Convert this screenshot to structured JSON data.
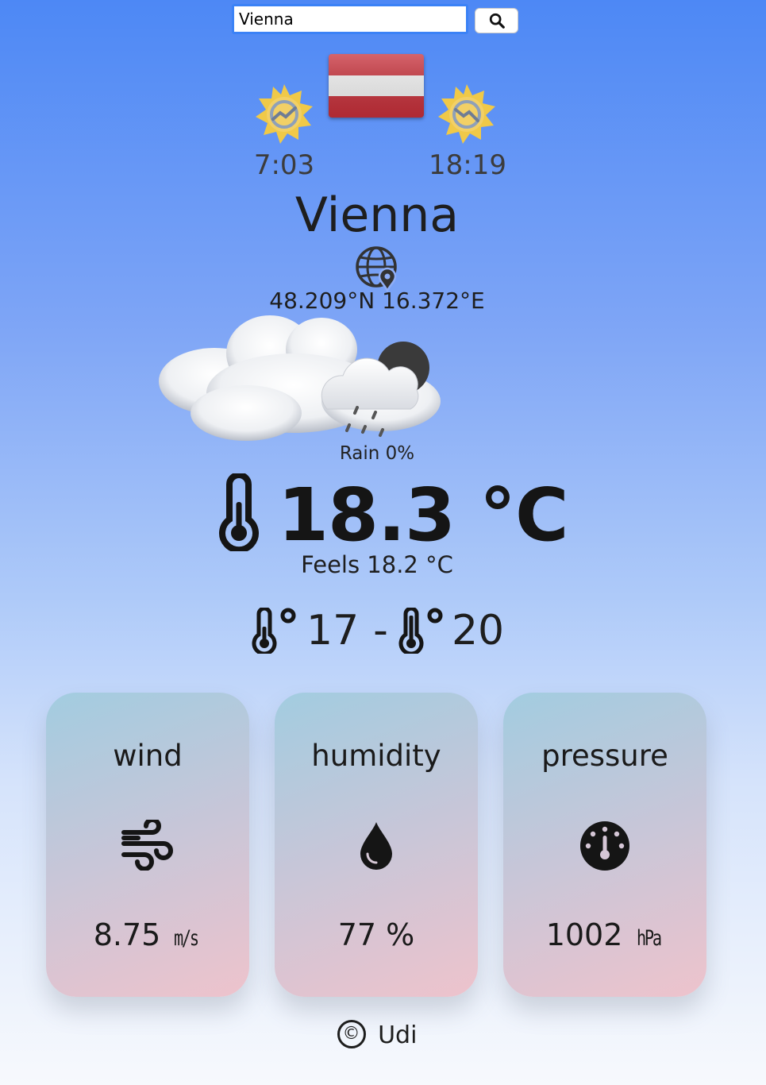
{
  "search": {
    "value": "Vienna"
  },
  "sun": {
    "sunrise": "7:03",
    "sunset": "18:19"
  },
  "location": {
    "city": "Vienna",
    "coords": "48.209°N 16.372°E"
  },
  "weather": {
    "rain": "Rain 0%",
    "temperature": "18.3 °C",
    "feels": "Feels 18.2 °C",
    "min": "17",
    "max": "20",
    "range_separator": "-"
  },
  "cards": {
    "wind": {
      "title": "wind",
      "value": "8.75",
      "unit": "m/s"
    },
    "humidity": {
      "title": "humidity",
      "value": "77 %"
    },
    "pressure": {
      "title": "pressure",
      "value": "1002",
      "unit": "hPa"
    }
  },
  "footer": {
    "copyright_symbol": "©",
    "author": "Udi"
  },
  "icons": {
    "search": "search-icon",
    "flag": "austria-flag-icon",
    "sunrise": "sunrise-icon",
    "sunset": "sunset-icon",
    "globe": "globe-location-icon",
    "weather": "cloud-rain-night-icon",
    "thermometer": "thermometer-icon",
    "wind": "wind-icon",
    "humidity": "droplet-icon",
    "pressure": "gauge-icon"
  },
  "colors": {
    "search_border": "#3b82f6",
    "flag_red": "#c8303a",
    "sun_yellow": "#f0c948"
  }
}
